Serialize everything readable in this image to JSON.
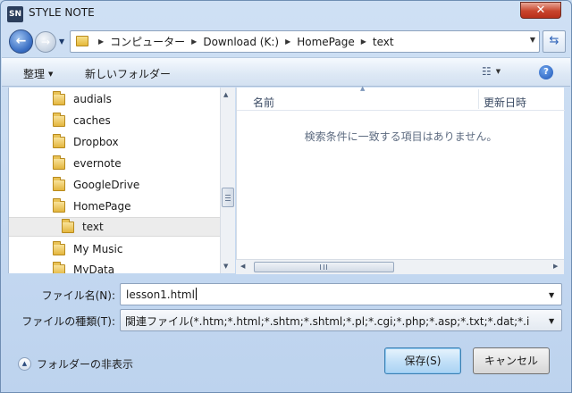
{
  "window": {
    "title": "STYLE NOTE",
    "app_icon_text": "SN",
    "close_label": "✕"
  },
  "address": {
    "crumbs": [
      "コンピューター",
      "Download (K:)",
      "HomePage",
      "text"
    ]
  },
  "toolbar": {
    "organize_label": "整理",
    "new_folder_label": "新しいフォルダー",
    "view_icon": "view-list-icon",
    "help_label": "?"
  },
  "tree": {
    "items": [
      {
        "label": "audials"
      },
      {
        "label": "caches"
      },
      {
        "label": "Dropbox"
      },
      {
        "label": "evernote"
      },
      {
        "label": "GoogleDrive"
      },
      {
        "label": "HomePage"
      },
      {
        "label": "text",
        "selected": true
      },
      {
        "label": "My Music"
      },
      {
        "label": "MyData"
      }
    ]
  },
  "filelist": {
    "col_name": "名前",
    "col_date": "更新日時",
    "empty_message": "検索条件に一致する項目はありません。"
  },
  "form": {
    "filename_label": "ファイル名(N):",
    "filename_value": "lesson1.html",
    "filetype_label": "ファイルの種類(T):",
    "filetype_value": "関連ファイル(*.htm;*.html;*.shtm;*.shtml;*.pl;*.cgi;*.php;*.asp;*.txt;*.dat;*.i"
  },
  "footer": {
    "hide_folders_label": "フォルダーの非表示",
    "save_label": "保存(S)",
    "cancel_label": "キャンセル"
  }
}
